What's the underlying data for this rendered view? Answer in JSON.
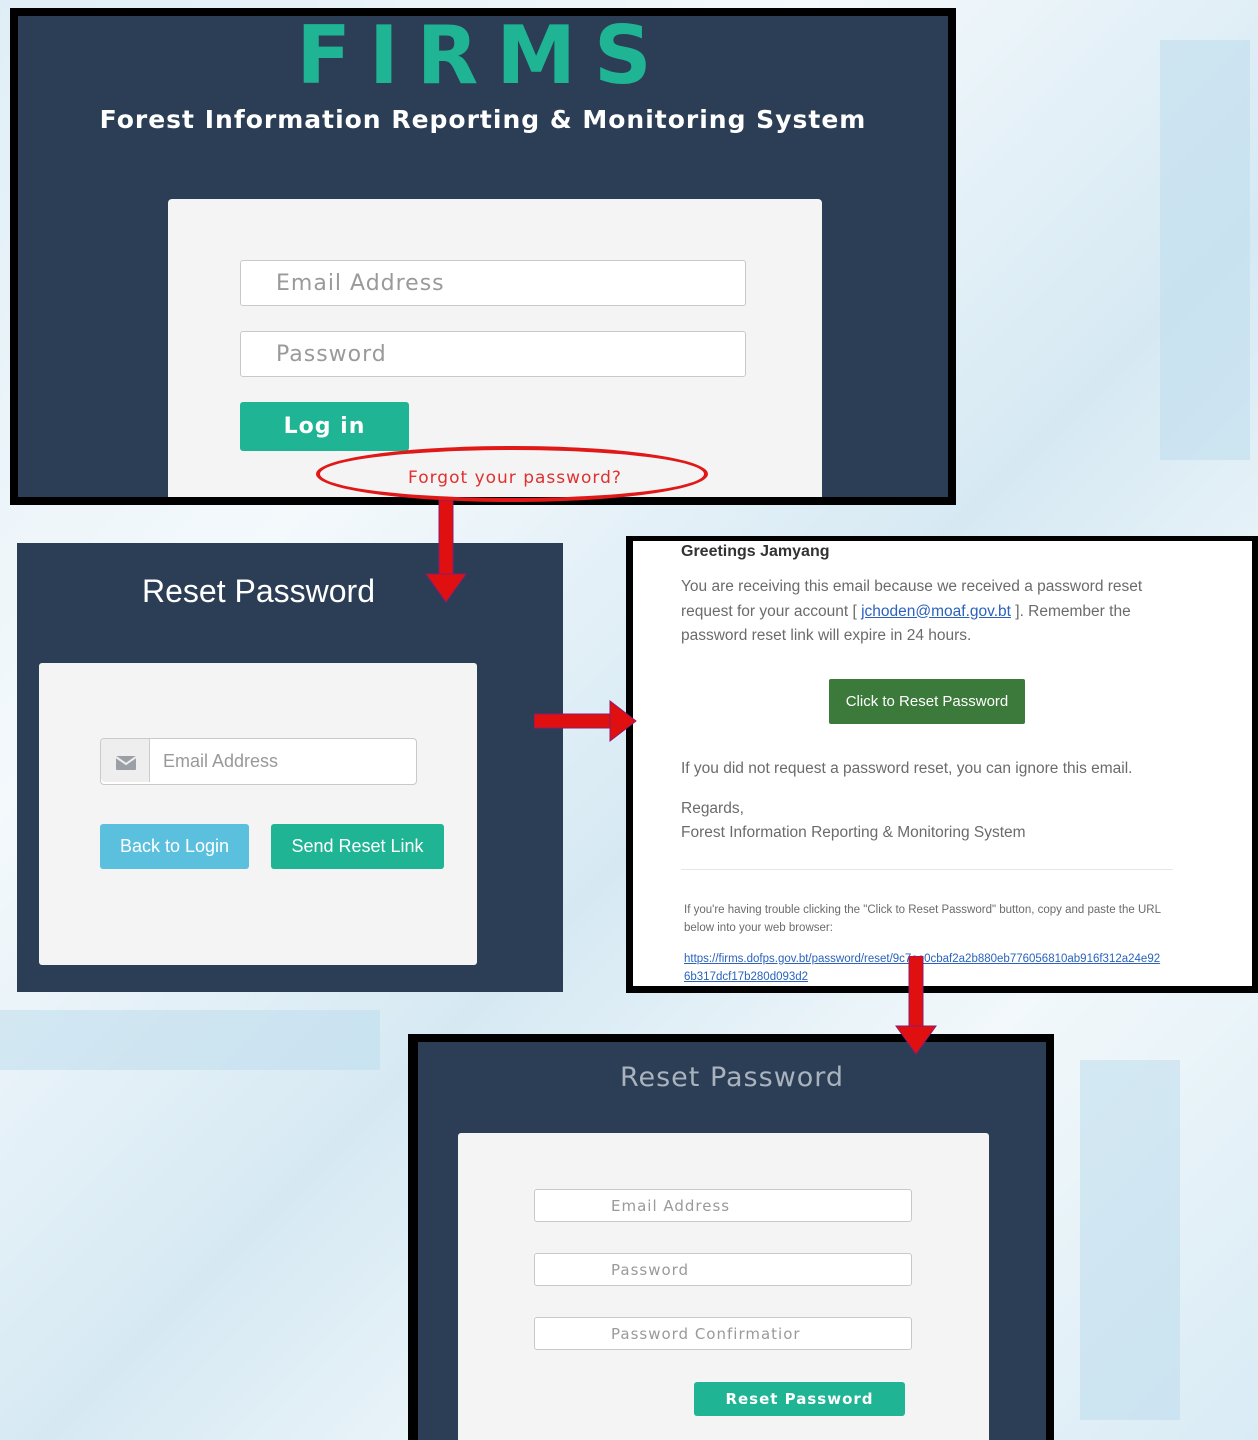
{
  "login_panel": {
    "brand": "FIRMS",
    "subtitle": "Forest Information Reporting & Monitoring System",
    "email_placeholder": "Email Address",
    "password_placeholder": "Password",
    "login_label": "Log in",
    "forgot_link": "Forgot your password?"
  },
  "reset_request_panel": {
    "title": "Reset Password",
    "email_placeholder": "Email Address",
    "back_label": "Back to Login",
    "send_label": "Send Reset Link",
    "icon": "envelope-icon"
  },
  "email_panel": {
    "greeting": "Greetings Jamyang",
    "body_before": "You are receiving this email because we received a password reset request for your account [ ",
    "account_email": "jchoden@moaf.gov.bt",
    "body_after": " ]. Remember the password reset link will expire in 24 hours.",
    "button_label": "Click to Reset Password",
    "ignore_text": "If you did not request a password reset, you can ignore this email.",
    "regards": "Regards,",
    "system_name": "Forest Information Reporting & Monitoring System",
    "trouble_text": "If you're having trouble clicking the \"Click to Reset Password\" button, copy and paste the URL below into your web browser:",
    "reset_url": "https://firms.dofps.gov.bt/password/reset/9c7ae0cbaf2a2b880eb776056810ab916f312a24e926b317dcf17b280d093d2"
  },
  "reset_form_panel": {
    "title": "Reset Password",
    "email_placeholder": "Email Address",
    "password_placeholder": "Password",
    "confirm_placeholder": "Password Confirmatior",
    "button_label": "Reset Password"
  },
  "colors": {
    "panel_bg": "#2b3e55",
    "accent_green": "#1fb494",
    "info_blue": "#5bc0de",
    "email_button": "#3b7a3a",
    "highlight_red": "#e01818"
  }
}
